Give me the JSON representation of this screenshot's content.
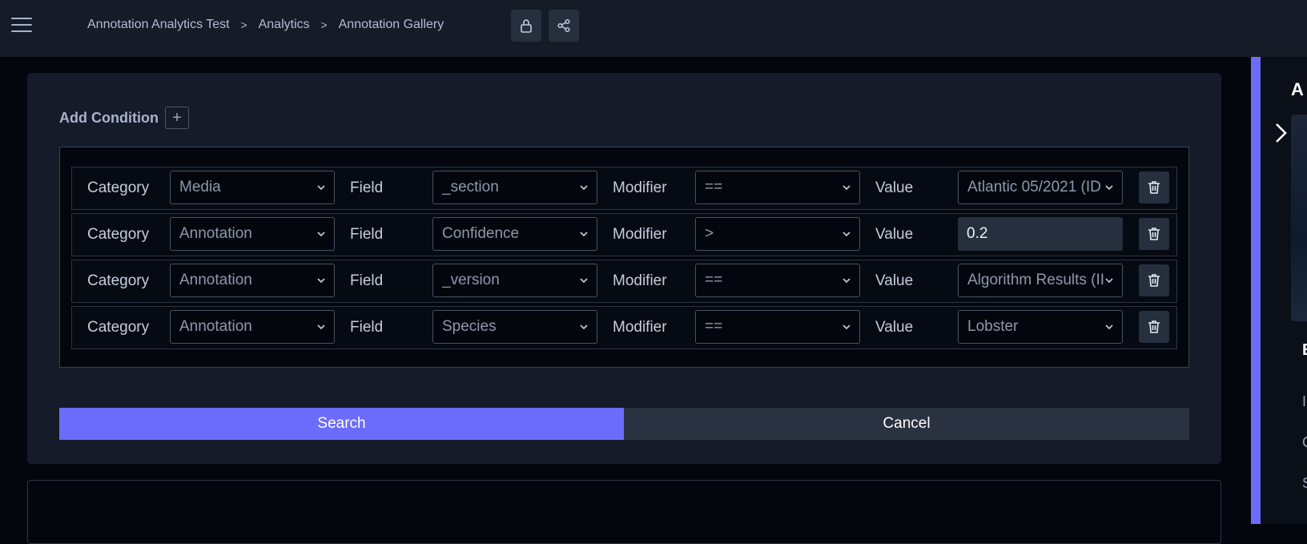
{
  "header": {
    "menu_icon": "hamburger-icon",
    "breadcrumb": [
      "Annotation Analytics Test",
      "Analytics",
      "Annotation Gallery"
    ],
    "breadcrumb_separator": ">",
    "lock_icon": "lock-icon",
    "share_icon": "share-icon"
  },
  "filter": {
    "add_condition_label": "Add Condition",
    "add_icon": "+",
    "conditions": [
      {
        "category_label": "Category",
        "category": "Media",
        "field_label": "Field",
        "field": "_section",
        "modifier_label": "Modifier",
        "modifier": "==",
        "value_label": "Value",
        "value": "Atlantic 05/2021 (ID",
        "value_type": "select"
      },
      {
        "category_label": "Category",
        "category": "Annotation",
        "field_label": "Field",
        "field": "Confidence",
        "modifier_label": "Modifier",
        "modifier": ">",
        "value_label": "Value",
        "value": "0.2",
        "value_type": "input"
      },
      {
        "category_label": "Category",
        "category": "Annotation",
        "field_label": "Field",
        "field": "_version",
        "modifier_label": "Modifier",
        "modifier": "==",
        "value_label": "Value",
        "value": "Algorithm Results (II",
        "value_type": "select"
      },
      {
        "category_label": "Category",
        "category": "Annotation",
        "field_label": "Field",
        "field": "Species",
        "modifier_label": "Modifier",
        "modifier": "==",
        "value_label": "Value",
        "value": "Lobster",
        "value_type": "select"
      }
    ],
    "search_label": "Search",
    "cancel_label": "Cancel"
  },
  "side_panel": {
    "title_partial": "A",
    "heading_partial": "E",
    "items_partial": [
      "I",
      "C",
      "S"
    ]
  },
  "colors": {
    "accent": "#6c6cfb",
    "background": "#03070d",
    "panel": "#151b28"
  }
}
